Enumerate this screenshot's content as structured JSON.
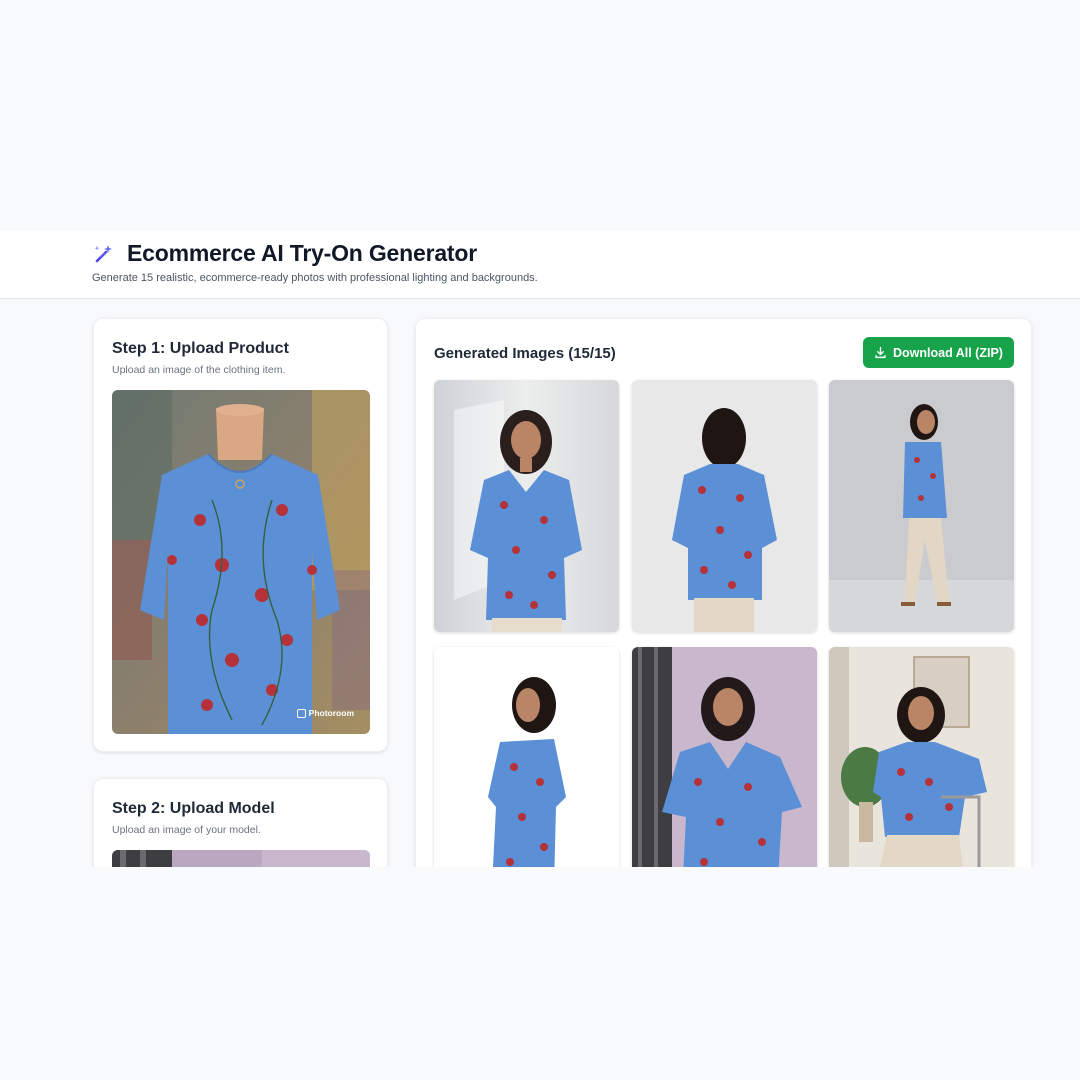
{
  "header": {
    "title": "Ecommerce AI Try-On Generator",
    "subtitle": "Generate 15 realistic, ecommerce-ready photos with professional lighting and backgrounds."
  },
  "step1": {
    "title": "Step 1: Upload Product",
    "description": "Upload an image of the clothing item.",
    "watermark": "Photoroom"
  },
  "step2": {
    "title": "Step 2: Upload Model",
    "description": "Upload an image of your model."
  },
  "results": {
    "title": "Generated Images (15/15)",
    "download_label": "Download All (ZIP)"
  },
  "colors": {
    "accent": "#4f46e5",
    "download": "#16a34a",
    "garment": "#5b8fd6"
  },
  "icons": [
    "sparkle-wand-icon",
    "download-icon"
  ]
}
